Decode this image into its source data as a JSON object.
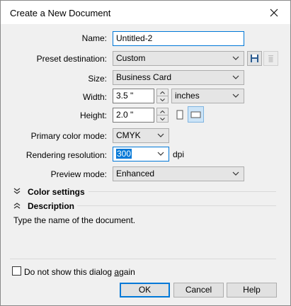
{
  "window": {
    "title": "Create a New Document",
    "close_glyph": "✕"
  },
  "form": {
    "name": {
      "label": "Name:",
      "value": "Untitled-2"
    },
    "preset": {
      "label": "Preset destination:",
      "value": "Custom"
    },
    "size": {
      "label": "Size:",
      "value": "Business Card"
    },
    "width": {
      "label": "Width:",
      "value": "3.5 \"",
      "unit": "inches"
    },
    "height": {
      "label": "Height:",
      "value": "2.0 \""
    },
    "color_mode": {
      "label": "Primary color mode:",
      "value": "CMYK"
    },
    "resolution": {
      "label": "Rendering resolution:",
      "value": "300",
      "unit": "dpi"
    },
    "preview": {
      "label": "Preview mode:",
      "value": "Enhanced"
    }
  },
  "sections": {
    "color_settings": "Color settings",
    "description": "Description",
    "description_text": "Type the name of the document."
  },
  "footer": {
    "checkbox_label_pre": "Do not show this dialog ",
    "checkbox_label_u": "a",
    "checkbox_label_post": "gain",
    "ok": "OK",
    "cancel": "Cancel",
    "help": "Help"
  },
  "colors": {
    "accent": "#0078d7",
    "dialog_bg": "#f0f0f0"
  },
  "icons": [
    "close-icon",
    "save-icon",
    "delete-icon",
    "chevron-down-icon",
    "spin-up-icon",
    "spin-down-icon",
    "portrait-icon",
    "landscape-icon",
    "collapse-icon",
    "expand-icon"
  ]
}
